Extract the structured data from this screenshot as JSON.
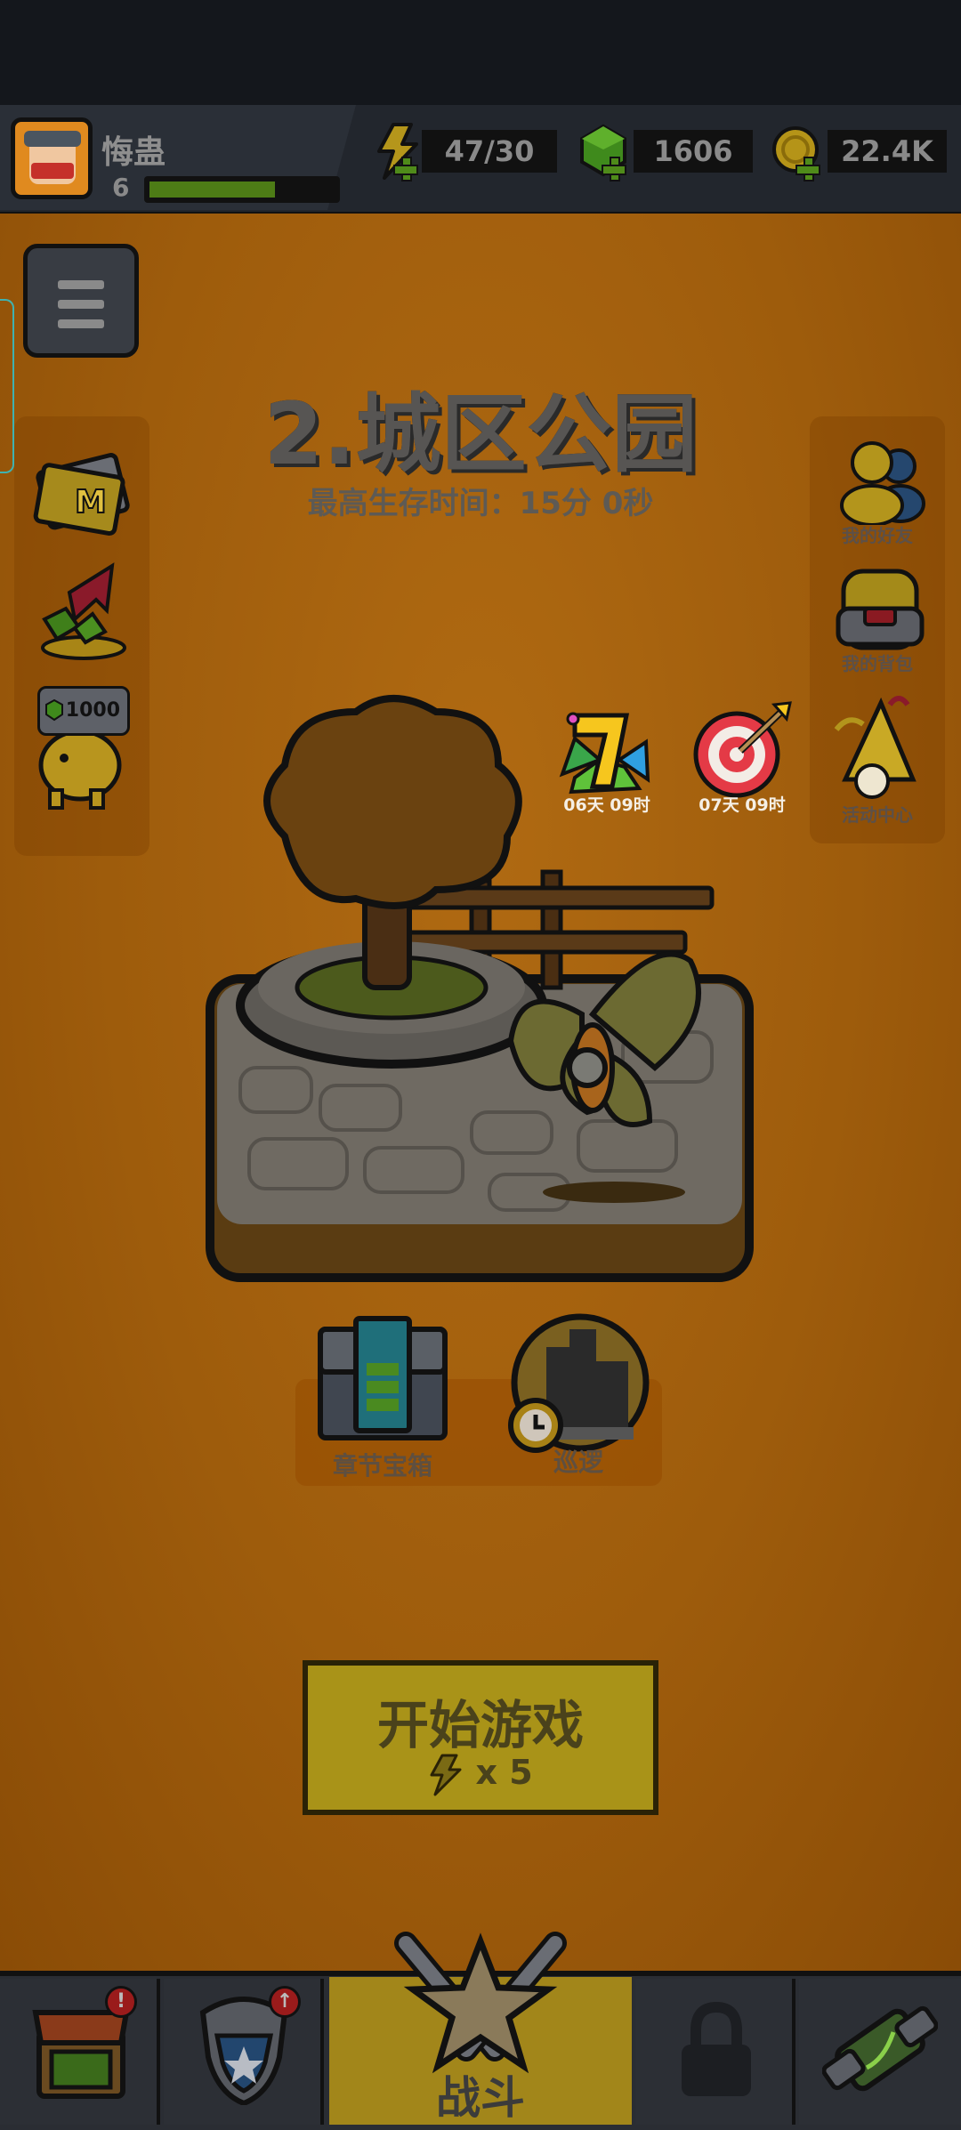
{
  "player": {
    "name": "悔蛊",
    "level": "6",
    "xp_progress": 0.68
  },
  "resources": {
    "energy": {
      "value": "47/30",
      "icon": "lightning-icon"
    },
    "gems": {
      "value": "1606",
      "icon": "gem-icon"
    },
    "coins": {
      "value": "22.4K",
      "icon": "coin-icon"
    }
  },
  "stage": {
    "title": "2.城区公园",
    "subtitle": "最高生存时间：15分 0秒"
  },
  "left_side": {
    "gem_reward": "1000"
  },
  "right_side": {
    "friends": "我的好友",
    "backpack": "我的背包",
    "events": "活动中心"
  },
  "timers": {
    "seven_day": "06天 09时",
    "target": "07天 09时"
  },
  "chapter": {
    "chest": "章节宝箱",
    "patrol": "巡逻"
  },
  "play": {
    "label": "开始游戏",
    "cost": "x 5"
  },
  "nav": {
    "battle": "战斗",
    "shop_badge": "!",
    "gear_badge": "↑"
  },
  "colors": {
    "accent": "#a99318",
    "background": "#9e5c0c"
  }
}
